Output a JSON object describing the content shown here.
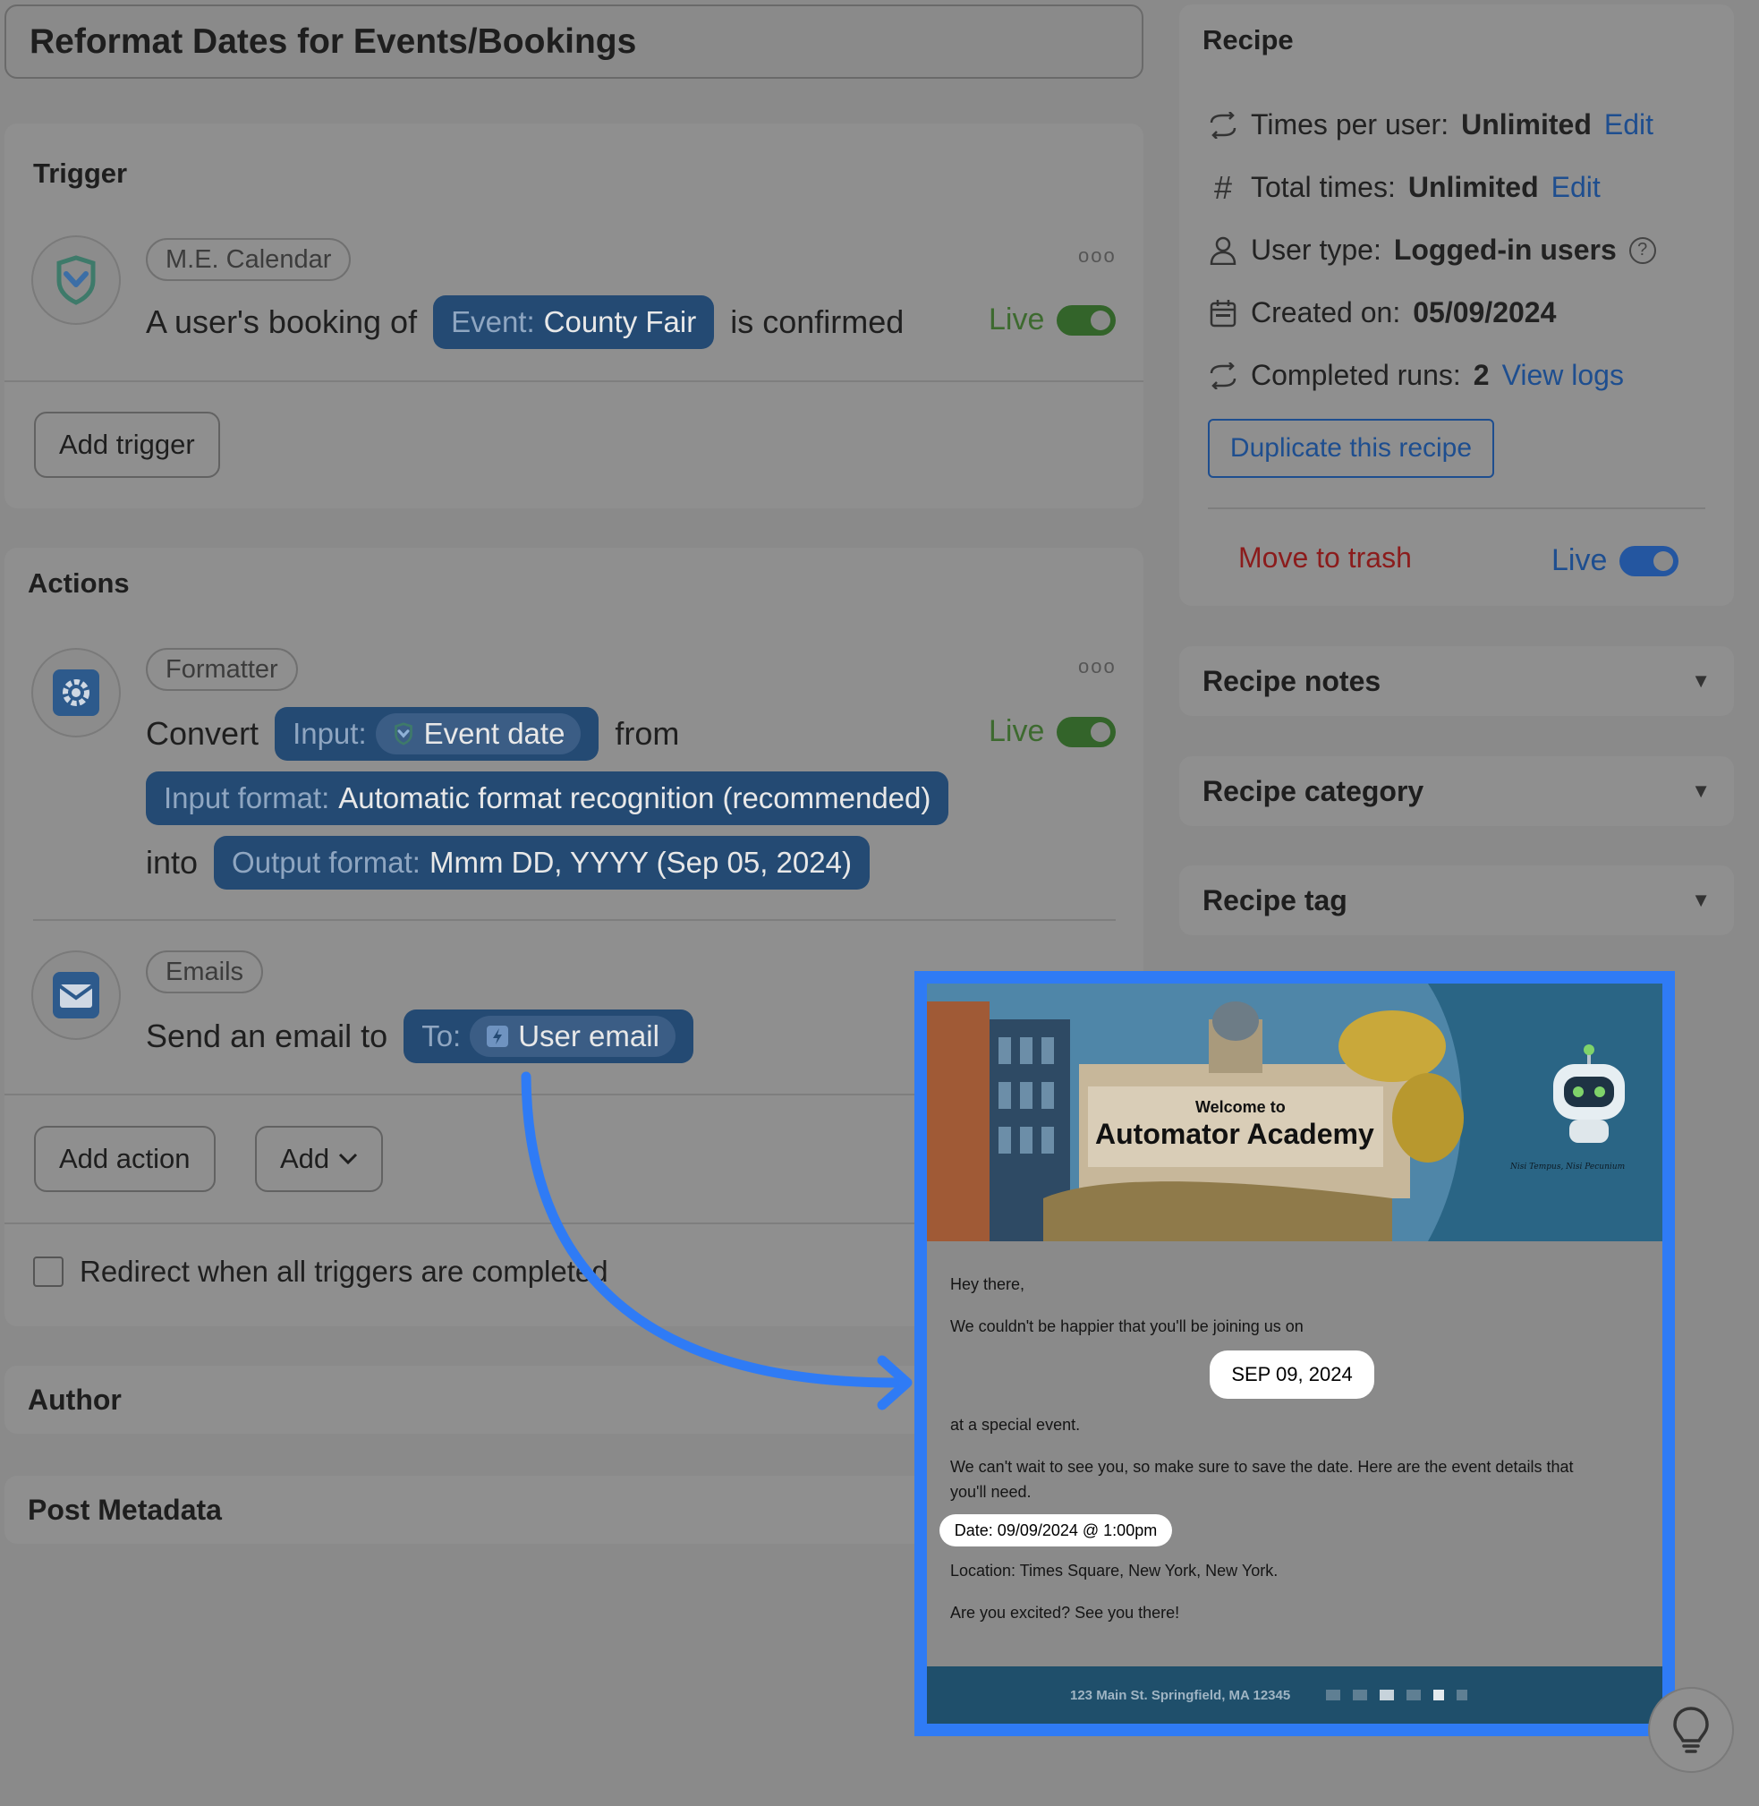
{
  "page": {
    "title": "Reformat Dates for Events/Bookings"
  },
  "trigger": {
    "heading": "Trigger",
    "app": "M.E. Calendar",
    "sentence_prefix": "A user's booking of",
    "token_label": "Event:",
    "token_value": "County Fair",
    "sentence_suffix": "is confirmed",
    "status": "Live",
    "add_button": "Add trigger"
  },
  "actions": {
    "heading": "Actions",
    "formatter": {
      "app": "Formatter",
      "verb": "Convert",
      "input_label": "Input:",
      "input_value": "Event date",
      "from_word": "from",
      "input_format_label": "Input format:",
      "input_format_value": "Automatic format recognition (recommended)",
      "into_word": "into",
      "output_format_label": "Output format:",
      "output_format_value": "Mmm DD, YYYY (Sep 05, 2024)",
      "status": "Live"
    },
    "email": {
      "app": "Emails",
      "sentence": "Send an email to",
      "to_label": "To:",
      "to_value": "User email"
    },
    "add_action_button": "Add action",
    "add_button": "Add",
    "redirect_label": "Redirect when all triggers are completed"
  },
  "author": {
    "heading": "Author"
  },
  "post_metadata": {
    "heading": "Post Metadata"
  },
  "recipe": {
    "heading": "Recipe",
    "times_per_user_label": "Times per user:",
    "times_per_user_value": "Unlimited",
    "total_times_label": "Total times:",
    "total_times_value": "Unlimited",
    "edit_link": "Edit",
    "user_type_label": "User type:",
    "user_type_value": "Logged-in users",
    "created_label": "Created on:",
    "created_value": "05/09/2024",
    "completed_label": "Completed runs:",
    "completed_value": "2",
    "view_logs": "View logs",
    "duplicate_button": "Duplicate this recipe",
    "trash_link": "Move to trash",
    "status": "Live"
  },
  "recipe_notes": "Recipe notes",
  "recipe_category": "Recipe category",
  "recipe_tag": "Recipe tag",
  "email_preview": {
    "banner_small": "Welcome to",
    "banner_big": "Automator Academy",
    "banner_motto": "Nisi Tempus, Nisi Pecunium",
    "greeting": "Hey there,",
    "line1": "We couldn't be happier that you'll be joining us on",
    "date_chip": "SEP 09, 2024",
    "line2": "at a special event.",
    "line3a": "We can't wait to see you, so make sure to save the date. Here are the event details that",
    "line3b": "you'll need.",
    "date_line": "Date: 09/09/2024 @ 1:00pm",
    "location_line": "Location: Times Square, New York, New York.",
    "closing": "Are you excited? See you there!",
    "footer_address": "123 Main St.  Springfield, MA 12345"
  },
  "colors": {
    "overlay_bg": "#8a8a8a",
    "pill_bg": "#244a73",
    "live_green": "#3d6a2f",
    "link_blue": "#1e4e8f",
    "trash_red": "#8b1c1c",
    "highlight_blue": "#2f7bf5"
  }
}
